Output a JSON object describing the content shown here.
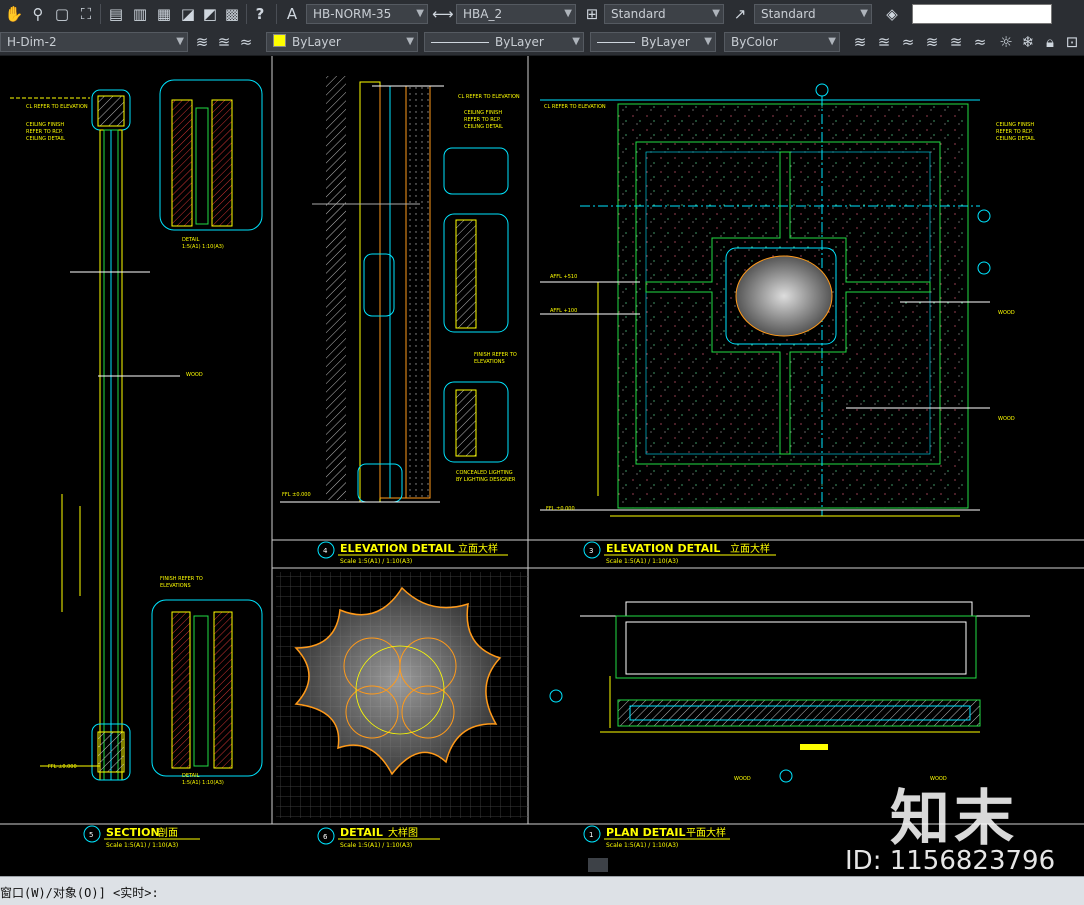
{
  "toolbar1": {
    "text_style": "HB-NORM-35",
    "dim_style": "HBA_2",
    "table_style": "Standard",
    "mleader_style": "Standard",
    "search_value": ""
  },
  "toolbar2": {
    "layer": "H-Dim-2",
    "color": "ByLayer",
    "linetype": "ByLayer",
    "lineweight": "ByLayer",
    "plot_style": "ByColor"
  },
  "colors": {
    "yellow": "#ffff00",
    "cyan": "#00e5ff",
    "green": "#22dd44",
    "orange": "#ff9a1a",
    "red": "#ff3030",
    "grid": "#444444"
  },
  "drawing": {
    "views": {
      "section": {
        "no": "5",
        "title": "SECTION",
        "cn": "剖面",
        "scale": "Scale  1:5(A1) / 1:10(A3)"
      },
      "elev_left": {
        "no": "4",
        "title": "ELEVATION   DETAIL",
        "cn": "立面大样",
        "scale": "Scale  1:5(A1) / 1:10(A3)"
      },
      "elev_right": {
        "no": "3",
        "title": "ELEVATION   DETAIL",
        "cn": "立面大样",
        "scale": "Scale  1:5(A1) / 1:10(A3)"
      },
      "detail": {
        "no": "6",
        "title": "DETAIL",
        "cn": "大样图",
        "scale": "Scale  1:5(A1) / 1:10(A3)"
      },
      "plan": {
        "no": "1",
        "title": "PLAN  DETAIL",
        "cn": "平面大样",
        "scale": "Scale  1:5(A1) / 1:10(A3)"
      }
    },
    "notes": {
      "cl_refer_1": "CL REFER TO ELEVATION",
      "ceiling_1": "CEILING FINISH",
      "ceiling_2": "REFER TO RCP.",
      "ceiling_3": "CEILING DETAIL",
      "finish_1": "FINISH REFER TO",
      "finish_2": "ELEVATIONS",
      "conceal_1": "CONCEALED LIGHTING",
      "conceal_2": "BY LIGHTING DESIGNER",
      "detail_a": "DETAIL",
      "detail_a_scale": "1:5(A1) 1:10(A3)",
      "ffl": "FFL ±0.000",
      "affl_1": "AFFL +510",
      "affl_2": "AFFL +100",
      "wood": "WOOD"
    }
  },
  "command_line": "窗口(W)/对象(O)] <实时>:",
  "watermark": {
    "brand": "知末",
    "id_text": "ID: 1156823796"
  }
}
